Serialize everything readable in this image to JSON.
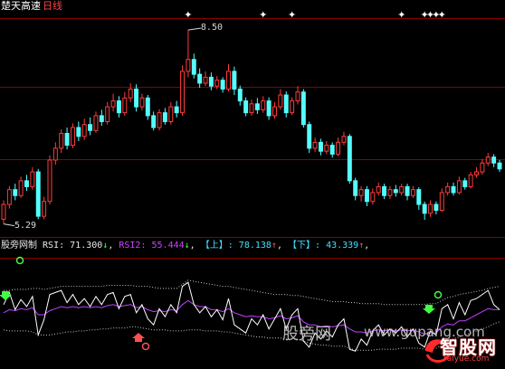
{
  "header": {
    "stock_name": "楚天高速",
    "period": "日线"
  },
  "price_panel": {
    "high_label": "8.50",
    "low_label": "5.29",
    "high_price": 8.5,
    "low_price": 5.29
  },
  "indicator": {
    "name": "股旁网制",
    "rsi_label": "RSI:",
    "rsi_value": "71.300",
    "rsi_arrow": "↓",
    "rsi2_label": "RSI2:",
    "rsi2_value": "55.444",
    "rsi2_arrow": "↓",
    "upper_label": "【上】:",
    "upper_value": "78.138",
    "upper_arrow": "↑",
    "lower_label": "【下】:",
    "lower_value": "43.339",
    "lower_arrow": "↑"
  },
  "watermark": {
    "site_cn": "股旁网",
    "site_url": "www.gupang.com",
    "logo_text": "智股网",
    "logo_url": "raiyue.com"
  },
  "colors": {
    "up_candle": "#ff3c3c",
    "down_candle": "#54ffff",
    "grid": "#8b0000",
    "rsi_line": "#ffffff",
    "rsi2_line": "#c040ff",
    "band_line": "#c8c8c8"
  },
  "chart_data": {
    "type": "candlestick",
    "candles": [
      {
        "o": 5.3,
        "c": 5.55,
        "h": 5.62,
        "l": 5.22
      },
      {
        "o": 5.55,
        "c": 5.8,
        "h": 5.86,
        "l": 5.48
      },
      {
        "o": 5.8,
        "c": 5.7,
        "h": 5.9,
        "l": 5.62
      },
      {
        "o": 5.7,
        "c": 5.95,
        "h": 6.02,
        "l": 5.66
      },
      {
        "o": 5.95,
        "c": 5.85,
        "h": 6.05,
        "l": 5.78
      },
      {
        "o": 5.85,
        "c": 6.1,
        "h": 6.18,
        "l": 5.8
      },
      {
        "o": 6.1,
        "c": 5.35,
        "h": 6.15,
        "l": 5.3
      },
      {
        "o": 5.35,
        "c": 5.6,
        "h": 5.68,
        "l": 5.3
      },
      {
        "o": 5.6,
        "c": 6.3,
        "h": 6.38,
        "l": 5.55
      },
      {
        "o": 6.3,
        "c": 6.5,
        "h": 6.6,
        "l": 6.22
      },
      {
        "o": 6.5,
        "c": 6.75,
        "h": 6.82,
        "l": 6.42
      },
      {
        "o": 6.75,
        "c": 6.55,
        "h": 6.85,
        "l": 6.48
      },
      {
        "o": 6.55,
        "c": 6.85,
        "h": 6.92,
        "l": 6.5
      },
      {
        "o": 6.85,
        "c": 6.7,
        "h": 6.95,
        "l": 6.62
      },
      {
        "o": 6.7,
        "c": 6.9,
        "h": 7.0,
        "l": 6.64
      },
      {
        "o": 6.9,
        "c": 6.8,
        "h": 7.02,
        "l": 6.72
      },
      {
        "o": 6.8,
        "c": 7.05,
        "h": 7.12,
        "l": 6.76
      },
      {
        "o": 7.05,
        "c": 6.95,
        "h": 7.15,
        "l": 6.88
      },
      {
        "o": 6.95,
        "c": 7.2,
        "h": 7.28,
        "l": 6.9
      },
      {
        "o": 7.2,
        "c": 7.3,
        "h": 7.42,
        "l": 7.12
      },
      {
        "o": 7.3,
        "c": 7.1,
        "h": 7.38,
        "l": 7.02
      },
      {
        "o": 7.1,
        "c": 7.35,
        "h": 7.45,
        "l": 7.05
      },
      {
        "o": 7.35,
        "c": 7.5,
        "h": 7.6,
        "l": 7.28
      },
      {
        "o": 7.5,
        "c": 7.2,
        "h": 7.58,
        "l": 7.12
      },
      {
        "o": 7.2,
        "c": 7.35,
        "h": 7.42,
        "l": 7.14
      },
      {
        "o": 7.35,
        "c": 7.05,
        "h": 7.4,
        "l": 6.98
      },
      {
        "o": 7.05,
        "c": 6.85,
        "h": 7.12,
        "l": 6.8
      },
      {
        "o": 6.85,
        "c": 7.1,
        "h": 7.16,
        "l": 6.8
      },
      {
        "o": 7.1,
        "c": 6.95,
        "h": 7.18,
        "l": 6.9
      },
      {
        "o": 6.95,
        "c": 7.2,
        "h": 7.28,
        "l": 6.9
      },
      {
        "o": 7.2,
        "c": 7.1,
        "h": 7.3,
        "l": 7.02
      },
      {
        "o": 7.1,
        "c": 7.8,
        "h": 7.9,
        "l": 7.05
      },
      {
        "o": 7.8,
        "c": 8.0,
        "h": 8.5,
        "l": 7.7
      },
      {
        "o": 8.0,
        "c": 7.75,
        "h": 8.1,
        "l": 7.68
      },
      {
        "o": 7.75,
        "c": 7.6,
        "h": 7.85,
        "l": 7.52
      },
      {
        "o": 7.6,
        "c": 7.7,
        "h": 7.8,
        "l": 7.55
      },
      {
        "o": 7.7,
        "c": 7.55,
        "h": 7.78,
        "l": 7.48
      },
      {
        "o": 7.55,
        "c": 7.65,
        "h": 7.72,
        "l": 7.5
      },
      {
        "o": 7.65,
        "c": 7.5,
        "h": 7.7,
        "l": 7.44
      },
      {
        "o": 7.5,
        "c": 7.8,
        "h": 7.92,
        "l": 7.46
      },
      {
        "o": 7.8,
        "c": 7.5,
        "h": 7.88,
        "l": 7.4
      },
      {
        "o": 7.5,
        "c": 7.3,
        "h": 7.56,
        "l": 7.22
      },
      {
        "o": 7.3,
        "c": 7.1,
        "h": 7.36,
        "l": 7.04
      },
      {
        "o": 7.1,
        "c": 7.25,
        "h": 7.32,
        "l": 7.05
      },
      {
        "o": 7.25,
        "c": 7.15,
        "h": 7.35,
        "l": 7.08
      },
      {
        "o": 7.15,
        "c": 7.3,
        "h": 7.38,
        "l": 7.1
      },
      {
        "o": 7.3,
        "c": 7.05,
        "h": 7.36,
        "l": 6.98
      },
      {
        "o": 7.05,
        "c": 7.2,
        "h": 7.28,
        "l": 7.0
      },
      {
        "o": 7.2,
        "c": 7.4,
        "h": 7.5,
        "l": 7.15
      },
      {
        "o": 7.4,
        "c": 7.1,
        "h": 7.46,
        "l": 7.02
      },
      {
        "o": 7.1,
        "c": 7.3,
        "h": 7.36,
        "l": 7.06
      },
      {
        "o": 7.3,
        "c": 7.45,
        "h": 7.55,
        "l": 7.24
      },
      {
        "o": 7.45,
        "c": 6.9,
        "h": 7.5,
        "l": 6.85
      },
      {
        "o": 6.9,
        "c": 6.5,
        "h": 6.95,
        "l": 6.42
      },
      {
        "o": 6.5,
        "c": 6.6,
        "h": 6.68,
        "l": 6.44
      },
      {
        "o": 6.6,
        "c": 6.45,
        "h": 6.66,
        "l": 6.38
      },
      {
        "o": 6.45,
        "c": 6.55,
        "h": 6.62,
        "l": 6.4
      },
      {
        "o": 6.55,
        "c": 6.4,
        "h": 6.6,
        "l": 6.34
      },
      {
        "o": 6.4,
        "c": 6.6,
        "h": 6.68,
        "l": 6.36
      },
      {
        "o": 6.6,
        "c": 6.7,
        "h": 6.78,
        "l": 6.55
      },
      {
        "o": 6.7,
        "c": 5.95,
        "h": 6.74,
        "l": 5.9
      },
      {
        "o": 5.95,
        "c": 5.7,
        "h": 6.0,
        "l": 5.62
      },
      {
        "o": 5.7,
        "c": 5.8,
        "h": 5.86,
        "l": 5.6
      },
      {
        "o": 5.8,
        "c": 5.6,
        "h": 5.86,
        "l": 5.52
      },
      {
        "o": 5.6,
        "c": 5.75,
        "h": 5.82,
        "l": 5.55
      },
      {
        "o": 5.75,
        "c": 5.85,
        "h": 5.92,
        "l": 5.7
      },
      {
        "o": 5.85,
        "c": 5.7,
        "h": 5.9,
        "l": 5.64
      },
      {
        "o": 5.7,
        "c": 5.8,
        "h": 5.86,
        "l": 5.64
      },
      {
        "o": 5.8,
        "c": 5.75,
        "h": 5.88,
        "l": 5.68
      },
      {
        "o": 5.75,
        "c": 5.85,
        "h": 5.9,
        "l": 5.7
      },
      {
        "o": 5.85,
        "c": 5.7,
        "h": 5.9,
        "l": 5.62
      },
      {
        "o": 5.7,
        "c": 5.8,
        "h": 5.86,
        "l": 5.66
      },
      {
        "o": 5.8,
        "c": 5.55,
        "h": 5.84,
        "l": 5.46
      },
      {
        "o": 5.55,
        "c": 5.4,
        "h": 5.6,
        "l": 5.29
      },
      {
        "o": 5.4,
        "c": 5.55,
        "h": 5.62,
        "l": 5.34
      },
      {
        "o": 5.55,
        "c": 5.45,
        "h": 5.6,
        "l": 5.38
      },
      {
        "o": 5.45,
        "c": 5.75,
        "h": 5.82,
        "l": 5.42
      },
      {
        "o": 5.75,
        "c": 5.85,
        "h": 5.92,
        "l": 5.7
      },
      {
        "o": 5.85,
        "c": 5.75,
        "h": 5.92,
        "l": 5.7
      },
      {
        "o": 5.75,
        "c": 5.95,
        "h": 6.02,
        "l": 5.72
      },
      {
        "o": 5.95,
        "c": 5.85,
        "h": 6.0,
        "l": 5.8
      },
      {
        "o": 5.85,
        "c": 6.05,
        "h": 6.1,
        "l": 5.82
      },
      {
        "o": 6.05,
        "c": 6.1,
        "h": 6.18,
        "l": 6.0
      },
      {
        "o": 6.1,
        "c": 6.25,
        "h": 6.32,
        "l": 6.05
      },
      {
        "o": 6.25,
        "c": 6.35,
        "h": 6.42,
        "l": 6.2
      },
      {
        "o": 6.35,
        "c": 6.25,
        "h": 6.4,
        "l": 6.18
      },
      {
        "o": 6.25,
        "c": 6.15,
        "h": 6.3,
        "l": 6.1
      }
    ],
    "marker_indices": [
      32,
      45,
      50,
      69,
      73,
      74,
      75,
      76
    ],
    "rsi": [
      60,
      72,
      55,
      65,
      58,
      68,
      30,
      45,
      70,
      72,
      74,
      62,
      70,
      60,
      66,
      58,
      68,
      60,
      70,
      72,
      56,
      68,
      70,
      52,
      60,
      46,
      40,
      56,
      48,
      60,
      52,
      78,
      82,
      60,
      52,
      58,
      48,
      55,
      45,
      66,
      40,
      36,
      32,
      46,
      40,
      50,
      36,
      46,
      56,
      36,
      50,
      56,
      24,
      18,
      32,
      26,
      34,
      28,
      40,
      46,
      16,
      14,
      26,
      20,
      34,
      40,
      30,
      36,
      32,
      38,
      28,
      36,
      22,
      18,
      34,
      30,
      56,
      60,
      46,
      62,
      50,
      64,
      66,
      70,
      74,
      60,
      55
    ],
    "rsi2": [
      52,
      55,
      54,
      56,
      55,
      57,
      50,
      50,
      54,
      56,
      58,
      57,
      58,
      57,
      58,
      57,
      58,
      57,
      59,
      60,
      58,
      59,
      60,
      57,
      58,
      55,
      53,
      54,
      53,
      55,
      54,
      60,
      64,
      60,
      58,
      58,
      55,
      55,
      53,
      56,
      52,
      50,
      48,
      49,
      48,
      48,
      46,
      47,
      49,
      46,
      47,
      49,
      43,
      40,
      40,
      38,
      39,
      38,
      39,
      40,
      36,
      33,
      33,
      32,
      34,
      35,
      34,
      35,
      34,
      35,
      34,
      35,
      33,
      31,
      32,
      32,
      38,
      41,
      40,
      44,
      44,
      47,
      50,
      53,
      56,
      55,
      55
    ],
    "upper": [
      74,
      74,
      75,
      75,
      75,
      76,
      76,
      75,
      76,
      77,
      78,
      78,
      78,
      78,
      78,
      78,
      78,
      78,
      79,
      79,
      79,
      79,
      79,
      78,
      78,
      78,
      77,
      76,
      76,
      76,
      76,
      80,
      84,
      83,
      82,
      81,
      80,
      79,
      78,
      78,
      77,
      76,
      75,
      74,
      73,
      72,
      71,
      70,
      70,
      70,
      69,
      69,
      68,
      67,
      66,
      65,
      64,
      63,
      63,
      63,
      62,
      62,
      61,
      61,
      61,
      61,
      60,
      60,
      60,
      60,
      60,
      60,
      60,
      60,
      61,
      61,
      64,
      67,
      68,
      70,
      71,
      72,
      73,
      74,
      76,
      77,
      78
    ],
    "lower": [
      35,
      34,
      34,
      34,
      34,
      33,
      30,
      30,
      30,
      31,
      32,
      33,
      33,
      34,
      34,
      35,
      35,
      36,
      36,
      37,
      37,
      37,
      38,
      38,
      37,
      36,
      35,
      35,
      35,
      34,
      34,
      34,
      35,
      35,
      35,
      34,
      34,
      34,
      33,
      33,
      32,
      31,
      30,
      29,
      28,
      28,
      27,
      27,
      27,
      26,
      26,
      26,
      24,
      22,
      21,
      20,
      20,
      19,
      19,
      19,
      17,
      15,
      15,
      15,
      15,
      16,
      16,
      16,
      16,
      17,
      17,
      17,
      17,
      16,
      16,
      17,
      20,
      24,
      26,
      28,
      30,
      32,
      34,
      36,
      38,
      41,
      43
    ],
    "ylim": [
      5.0,
      8.7
    ]
  }
}
